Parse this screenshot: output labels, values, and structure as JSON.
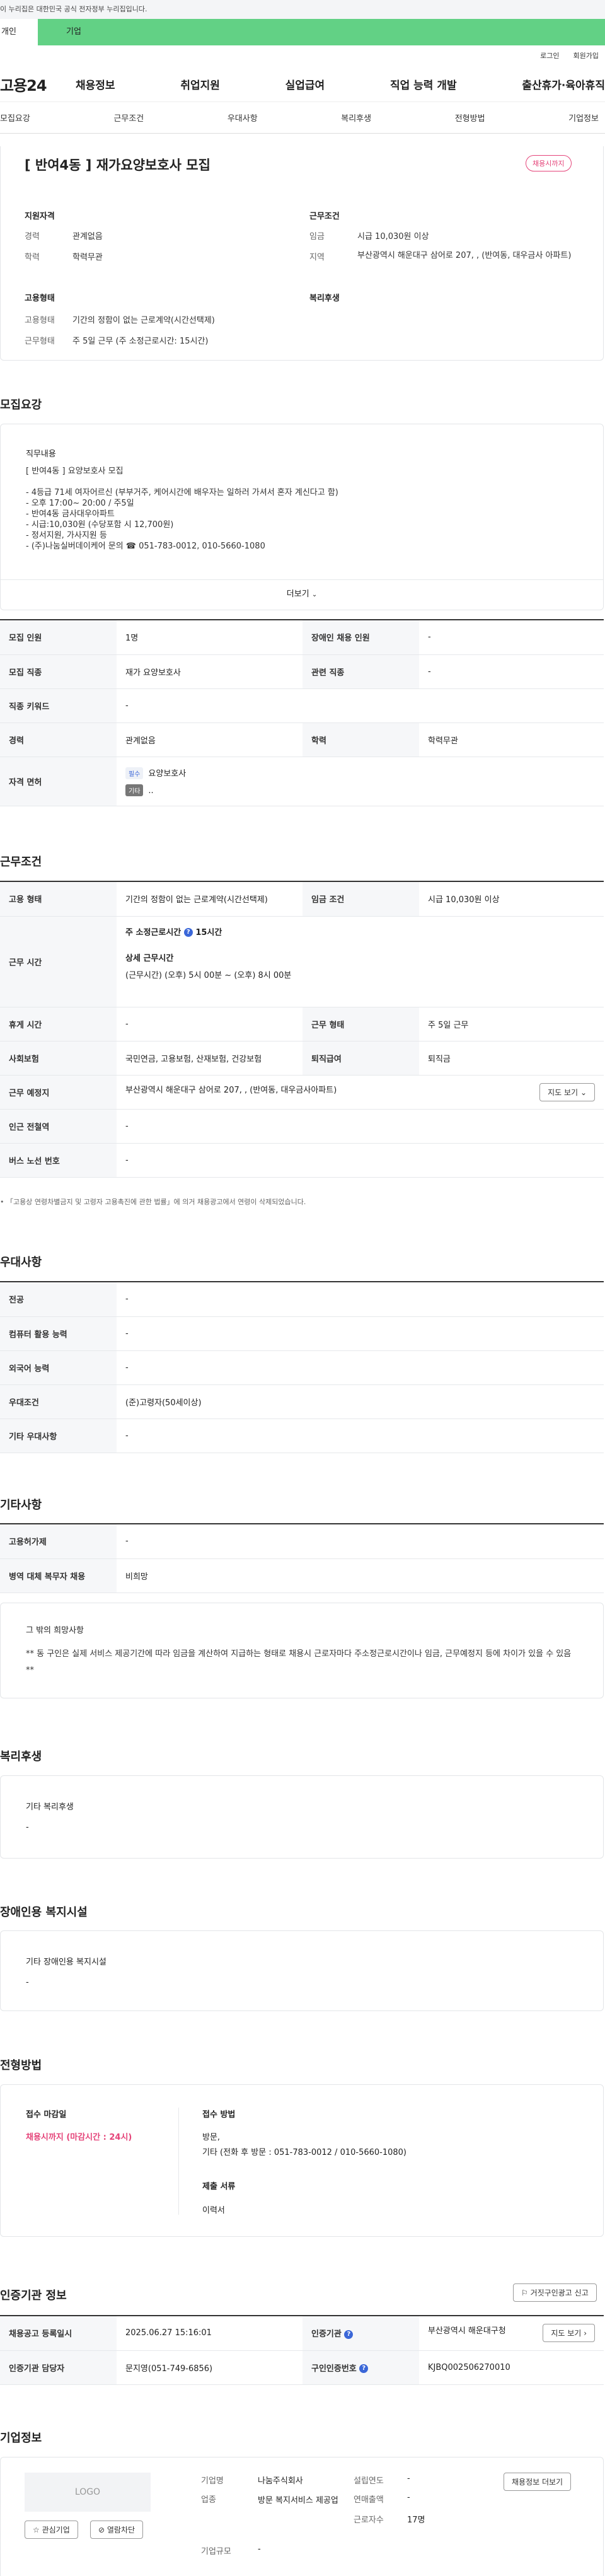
{
  "gov_banner": "이 누리집은 대한민국 공식 전자정부 누리집입니다.",
  "user_tabs": [
    "개인",
    "기업"
  ],
  "util": [
    "로그인",
    "회원가입"
  ],
  "gnb": {
    "logo": "고용24",
    "menu": [
      "채용정보",
      "취업지원",
      "실업급여",
      "직업 능력 개발",
      "출산휴가·육아휴직"
    ]
  },
  "subnav": [
    "모집요강",
    "근무조건",
    "우대사항",
    "복리후생",
    "전형방법",
    "기업정보"
  ],
  "summary": {
    "title": "[ 반여4동 ] 재가요양보호사 모집",
    "badge": "채용시까지",
    "qual_title": "지원자격",
    "cond_title": "근무조건",
    "qual": [
      {
        "k": "경력",
        "v": "관계없음"
      },
      {
        "k": "학력",
        "v": "학력무관"
      }
    ],
    "cond": [
      {
        "k": "임금",
        "v": "시급 10,030원 이상"
      },
      {
        "k": "지역",
        "v": "부산광역시 해운대구 삼어로 207, , (반여동, 대우금사 아파트)"
      }
    ],
    "type_title": "고용형태",
    "welfare_title": "복리후생",
    "type": [
      {
        "k": "고용형태",
        "v": "기간의 정함이 없는 근로계약(시간선택제)"
      },
      {
        "k": "근무형태",
        "v": "주 5일 근무 (주 소정근로시간: 15시간)"
      }
    ]
  },
  "recruit": {
    "section_title": "모집요강",
    "duty_title": "직무내용",
    "duty_lines": [
      "[ 반여4동 ] 요양보호사 모집",
      "",
      "- 4등급 71세 여자어르신 (부부거주, 케어시간에 배우자는 일하러 가셔서  혼자 계신다고 함)",
      "- 오후 17:00~ 20:00  / 주5일",
      "- 반여4동 금사대우아파트",
      "- 시급:10,030원 (수당포함 시 12,700원)",
      "- 정서지원, 가사지원 등",
      "- (주)나눔실버데이케어 문의 ☎ 051-783-0012, 010-5660-1080"
    ],
    "more": "더보기",
    "rows": [
      {
        "k1": "모집 인원",
        "v1": "1명",
        "k2": "장애인 채용 인원",
        "v2": "-"
      },
      {
        "k1": "모집 직종",
        "v1": "재가 요양보호사",
        "k2": "관련 직종",
        "v2": "-"
      },
      {
        "k1": "직종 키워드",
        "v1": "-"
      },
      {
        "k1": "경력",
        "v1": "관계없음",
        "k2": "학력",
        "v2": "학력무관"
      }
    ],
    "license_label": "자격 면허",
    "license_tag1": "필수",
    "license_name": "요양보호사",
    "license_tag2": "기타",
    "license_etc": ".."
  },
  "work": {
    "section_title": "근무조건",
    "type_k": "고용 형태",
    "type_v": "기간의 정함이 없는 근로계약(시간선택제)",
    "wage_k": "임금 조건",
    "wage_v": "시급 10,030원 이상",
    "hours_k": "근무 시간",
    "hours_week": "주 소정근로시간",
    "hours_week_v": "15시간",
    "hours_detail_title": "상세 근무시간",
    "hours_detail": "(근무시간) (오후) 5시 00분 ~ (오후) 8시 00분",
    "rows": [
      {
        "k1": "휴게 시간",
        "v1": "-",
        "k2": "근무 형태",
        "v2": "주 5일 근무"
      },
      {
        "k1": "사회보험",
        "v1": "국민연금, 고용보험, 산재보험, 건강보험",
        "k2": "퇴직급여",
        "v2": "퇴직금"
      }
    ],
    "place_k": "근무 예정지",
    "place_v": "부산광역시 해운대구 삼어로 207, , (반여동, 대우금사아파트)",
    "map_btn": "지도 보기",
    "subway_k": "인근 전철역",
    "subway_v": "-",
    "bus_k": "버스 노선 번호",
    "bus_v": "-",
    "notice": "「고용상 연령차별금지 및 고령자 고용촉진에 관한 법률」에 의거 채용광고에서 연령이 삭제되었습니다."
  },
  "pref": {
    "section_title": "우대사항",
    "rows": [
      {
        "k": "전공",
        "v": "-"
      },
      {
        "k": "컴퓨터 활용 능력",
        "v": "-"
      },
      {
        "k": "외국어 능력",
        "v": "-"
      },
      {
        "k": "우대조건",
        "v": "(준)고령자(50세이상)"
      },
      {
        "k": "기타 우대사항",
        "v": "-"
      }
    ]
  },
  "etc": {
    "section_title": "기타사항",
    "rows": [
      {
        "k": "고용허가제",
        "v": "-"
      },
      {
        "k": "병역 대체 복무자 채용",
        "v": "비희망"
      }
    ],
    "note_title": "그 밖의 희망사항",
    "note": "** 동 구인은 실제 서비스 제공기간에 따라 임금을 계산하여 지급하는 형태로 채용시 근로자마다 주소정근로시간이나 임금, 근무예정지 등에 차이가 있을 수 있음 **"
  },
  "welfare": {
    "section_title": "복리후생",
    "title": "기타 복리후생",
    "value": "-"
  },
  "facility": {
    "section_title": "장애인용 복지시설",
    "title": "기타 장애인용 복지시설",
    "value": "-"
  },
  "process": {
    "section_title": "전형방법",
    "deadline_title": "접수 마감일",
    "deadline": "채용시까지 (마감시간 : 24시)",
    "method_title": "접수 방법",
    "method_1": "방문,",
    "method_2": "기타 (전화 후 방문 : 051-783-0012 / 010-5660-1080)",
    "docs_title": "제출 서류",
    "docs": "이력서"
  },
  "agency": {
    "section_title": "인증기관 정보",
    "report_btn": "거짓구인광고 신고",
    "reg_k": "채용공고 등록일시",
    "reg_v": "2025.06.27 15:16:01",
    "org_k": "인증기관",
    "org_v": "부산광역시 해운대구청",
    "map_btn": "지도 보기",
    "mgr_k": "인증기관 담당자",
    "mgr_v": "문지영(051-749-6856)",
    "no_k": "구인인증번호",
    "no_v": "KJBQ002506270010"
  },
  "company": {
    "section_title": "기업정보",
    "logo": "LOGO",
    "interest_btn": "관심기업",
    "block_btn": "열람차단",
    "list_btn": "채용정보 더보기",
    "fields": [
      {
        "k": "기업명",
        "v": "나눔주식회사"
      },
      {
        "k": "설립연도",
        "v": "-"
      },
      {
        "k": "업종",
        "v": "방문 복지서비스 제공업"
      },
      {
        "k": "연매출액",
        "v": "-"
      },
      {
        "k": "근로자수",
        "v": "17명"
      },
      {
        "k": "기업규모",
        "v": "-"
      }
    ]
  }
}
